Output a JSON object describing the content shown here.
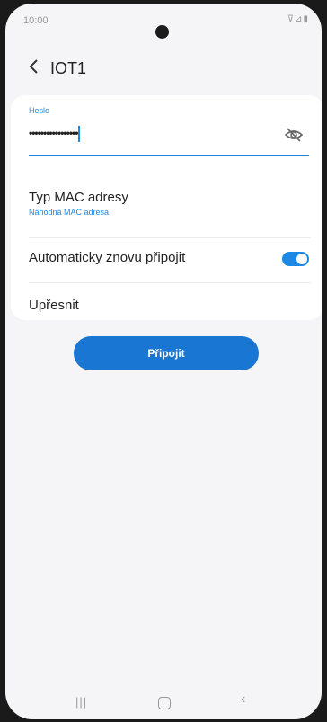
{
  "status_bar": {
    "time": "10:00",
    "icons": "⊽⊿▮"
  },
  "header": {
    "title": "IOT1"
  },
  "password": {
    "label": "Heslo",
    "value": "•••••••••••••••••"
  },
  "mac": {
    "title": "Typ MAC adresy",
    "value": "Náhodná MAC adresa"
  },
  "auto_reconnect": {
    "label": "Automaticky znovu připojit",
    "enabled": true
  },
  "advanced": {
    "label": "Upřesnit"
  },
  "connect": {
    "label": "Připojit"
  },
  "colors": {
    "accent": "#1e88e5",
    "button": "#1976d2",
    "background": "#f5f5f7"
  }
}
